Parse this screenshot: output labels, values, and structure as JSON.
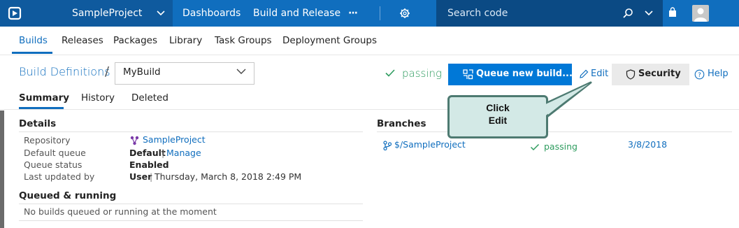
{
  "topbar": {
    "project": "SampleProject",
    "nav": [
      "Dashboards",
      "Build and Release"
    ],
    "more": "···",
    "search_placeholder": "Search code"
  },
  "subnav": [
    "Builds",
    "Releases",
    "Packages",
    "Library",
    "Task Groups",
    "Deployment Groups"
  ],
  "header": {
    "breadcrumb": "Build Definitions",
    "separator": "/",
    "definition": "MyBuild",
    "status": "passing",
    "queue_button": "Queue new build...",
    "edit": "Edit",
    "security": "Security",
    "help": "Help"
  },
  "tabs": [
    "Summary",
    "History",
    "Deleted"
  ],
  "details": {
    "title": "Details",
    "repository_label": "Repository",
    "repository_value": "SampleProject",
    "queue_label": "Default queue",
    "queue_value": "Default",
    "queue_sep": "|",
    "queue_manage": "Manage",
    "status_label": "Queue status",
    "status_value": "Enabled",
    "updated_label": "Last updated by",
    "updated_user": "User",
    "updated_sep": "|",
    "updated_date": "Thursday, March 8, 2018 2:49 PM"
  },
  "queued": {
    "title": "Queued & running",
    "message": "No builds queued or running at the moment"
  },
  "branches": {
    "title": "Branches",
    "rows": [
      {
        "name": "$/SampleProject",
        "status": "passing",
        "date": "3/8/2018"
      }
    ]
  },
  "callout": {
    "line1": "Click",
    "line2": "Edit"
  },
  "colors": {
    "accent": "#106ebe",
    "success": "#2e9c5f",
    "callout_fill": "#d3e9e6",
    "callout_border": "#4d7a71"
  }
}
